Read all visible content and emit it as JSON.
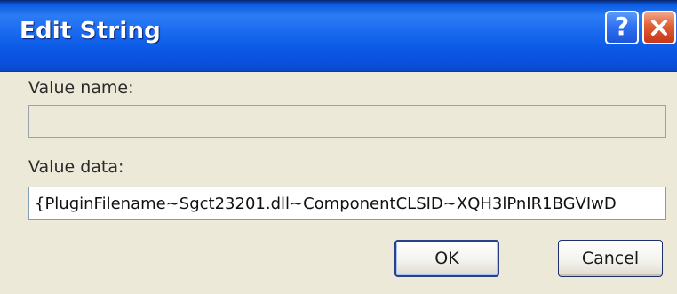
{
  "dialog": {
    "title": "Edit String",
    "help_button_label": "?",
    "close_button_icon": "close-icon"
  },
  "value_name": {
    "label": "Value name:",
    "value": ""
  },
  "value_data": {
    "label": "Value data:",
    "value": "{PluginFilename~Sgct23201.dll~ComponentCLSID~XQH3lPnIR1BGVIwD"
  },
  "buttons": {
    "ok_label": "OK",
    "cancel_label": "Cancel"
  },
  "colors": {
    "titlebar": "#0a58e4",
    "window_background": "#ece9d8",
    "close_button": "#e35c34"
  }
}
